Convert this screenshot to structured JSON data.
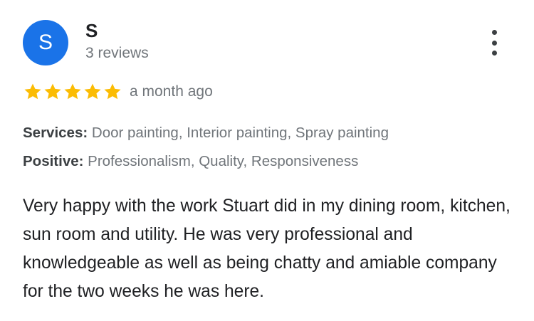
{
  "colors": {
    "avatar_bg": "#1a73e8",
    "star": "#fbbc04",
    "text_primary": "#202124",
    "text_secondary": "#70757a"
  },
  "reviewer": {
    "initial": "S",
    "name": "S",
    "review_count": "3 reviews",
    "more_icon": "more-vert-icon"
  },
  "rating": {
    "stars": 5,
    "max_stars": 5,
    "date": "a month ago"
  },
  "attributes": {
    "services_label": "Services:",
    "services_value": "Door painting, Interior painting, Spray painting",
    "positive_label": "Positive:",
    "positive_value": "Professionalism, Quality, Responsiveness"
  },
  "review": {
    "text": "Very happy with the work Stuart did in my dining room, kitchen, sun room and utility. He was very professional and knowledgeable as well as being chatty and amiable company for the two weeks he was here."
  }
}
